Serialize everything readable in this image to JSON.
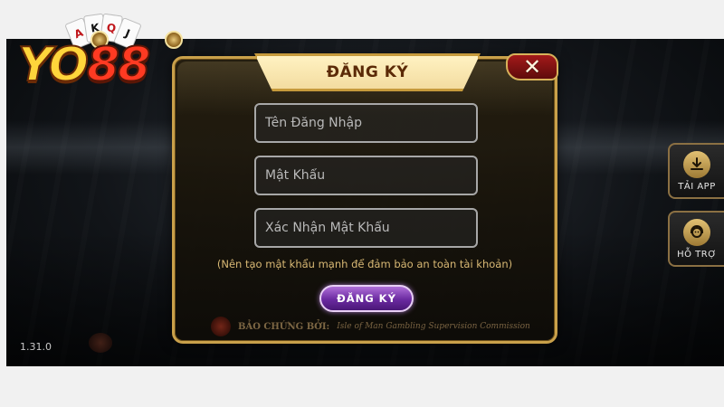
{
  "brand": {
    "logo_text_a": "YO",
    "logo_text_b": "88",
    "card_ranks": [
      "A",
      "K",
      "Q",
      "J"
    ]
  },
  "footer": {
    "version": "1.31.0"
  },
  "side": {
    "app_label": "TẢI APP",
    "support_label": "HỖ TRỢ"
  },
  "dialog": {
    "title": "ĐĂNG KÝ",
    "close_label": "✕",
    "fields": {
      "username_placeholder": "Tên Đăng Nhập",
      "password_placeholder": "Mật Khẩu",
      "confirm_placeholder": "Xác Nhận Mật Khẩu"
    },
    "hint": "(Nên tạo mật khẩu mạnh để đảm bảo an toàn tài khoản)",
    "submit_label": "ĐĂNG KÝ",
    "cert_label": "BẢO CHỨNG BỞI:",
    "cert_org": "Isle of Man Gambling Supervision Commission"
  },
  "icons": {
    "download": "download-icon",
    "support": "support-agent-icon",
    "close": "close-icon"
  },
  "colors": {
    "gold": "#c9a04a",
    "title_text": "#5b2a07",
    "close_red": "#a31a1a",
    "submit_purple": "#6a2aa0",
    "hint_gold": "#d8b874"
  }
}
